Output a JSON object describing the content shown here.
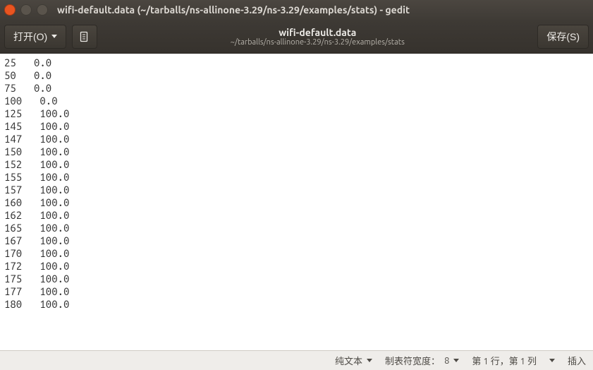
{
  "window": {
    "title": "wifi-default.data (~/tarballs/ns-allinone-3.29/ns-3.29/examples/stats) - gedit"
  },
  "toolbar": {
    "open_label": "打开(O)",
    "save_label": "保存(S)",
    "filename": "wifi-default.data",
    "filepath": "~/tarballs/ns-allinone-3.29/ns-3.29/examples/stats"
  },
  "file_content_lines": [
    "25   0.0",
    "50   0.0",
    "75   0.0",
    "100   0.0",
    "125   100.0",
    "145   100.0",
    "147   100.0",
    "150   100.0",
    "152   100.0",
    "155   100.0",
    "157   100.0",
    "160   100.0",
    "162   100.0",
    "165   100.0",
    "167   100.0",
    "170   100.0",
    "172   100.0",
    "175   100.0",
    "177   100.0",
    "180   100.0"
  ],
  "statusbar": {
    "syntax": "纯文本",
    "tab_width_label": "制表符宽度：",
    "tab_width_value": "8",
    "cursor": "第 1 行，第 1 列",
    "insert_mode": "插入"
  }
}
